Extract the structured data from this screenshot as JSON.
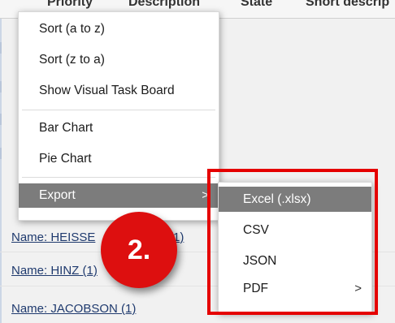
{
  "table": {
    "columns": [
      "Priority",
      "Description",
      "State",
      "Short descrip"
    ],
    "group_rows": [
      "Name: HEISSE",
      "(1)",
      "Name: HINZ (1)",
      "Name: JACOBSON (1)"
    ]
  },
  "context_menu": {
    "items": [
      {
        "label": "Sort (a to z)"
      },
      {
        "label": "Sort (z to a)"
      },
      {
        "label": "Show Visual Task Board"
      },
      {
        "label": "Bar Chart"
      },
      {
        "label": "Pie Chart"
      },
      {
        "label": "Export",
        "arrow": ">"
      }
    ]
  },
  "export_submenu": {
    "items": [
      {
        "label": "Excel (.xlsx)"
      },
      {
        "label": "CSV"
      },
      {
        "label": "JSON"
      },
      {
        "label": "PDF",
        "arrow": ">"
      }
    ]
  },
  "annotation": {
    "step_label": "2."
  },
  "colors": {
    "menu_active": "#7c7c7c",
    "highlight": "#e50000",
    "badge": "#dd0f0f"
  }
}
